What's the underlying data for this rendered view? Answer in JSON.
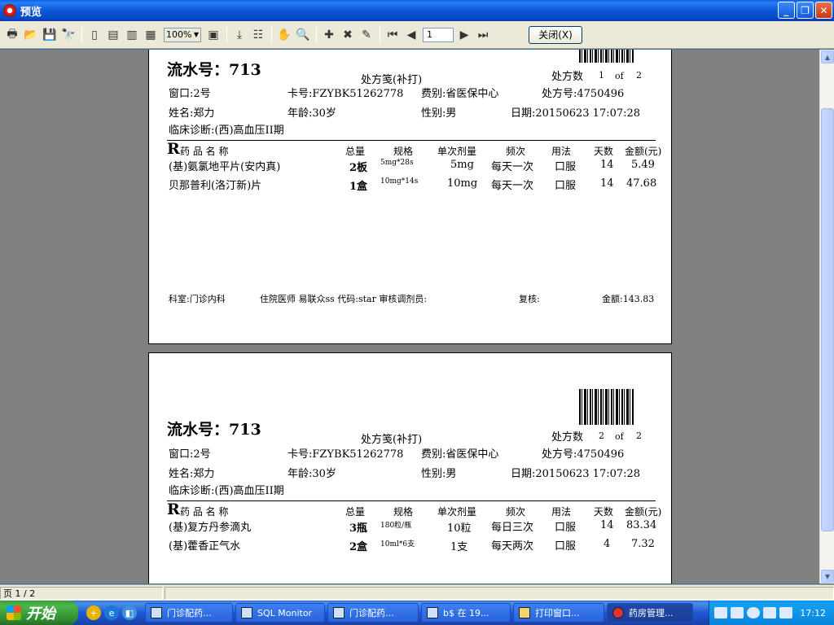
{
  "window": {
    "title": "预览",
    "minimize": "_",
    "maximize": "❐",
    "close": "✕"
  },
  "toolbar": {
    "zoom": "100%",
    "page_input": "1",
    "close_label": "关闭(X)"
  },
  "pages": [
    {
      "serial": "流水号：713",
      "header_title": "处方笺(补打)",
      "count_label": "处方数",
      "count_current": "1",
      "count_of": "of",
      "count_total": "2",
      "window_no": "窗口:2号",
      "card_no": "卡号:FZYBK51262778",
      "fee_type": "费别:省医保中心",
      "rx_no": "处方号:4750496",
      "name": "姓名:郑力",
      "age": "年龄:30岁",
      "gender": "性别:男",
      "date": "日期:20150623 17:07:28",
      "diagnosis": "临床诊断:(西)高血压II期",
      "rows": [
        {
          "name": "(基)氨氯地平片(安内真)",
          "qty": "2板",
          "spec": "5mg*28s",
          "dose": "5mg",
          "freq": "每天一次",
          "usage": "口服",
          "days": "14",
          "amount": "5.49"
        },
        {
          "name": "贝那普利(洛汀新)片",
          "qty": "1盒",
          "spec": "10mg*14s",
          "dose": "10mg",
          "freq": "每天一次",
          "usage": "口服",
          "days": "14",
          "amount": "47.68"
        }
      ],
      "footer": {
        "dept": "科室:门诊内科",
        "doctor": "住院医师 易联众ss 代码:star 审核调剂员:",
        "review": "复核:",
        "total": "金额:143.83"
      }
    },
    {
      "serial": "流水号：713",
      "header_title": "处方笺(补打)",
      "count_label": "处方数",
      "count_current": "2",
      "count_of": "of",
      "count_total": "2",
      "window_no": "窗口:2号",
      "card_no": "卡号:FZYBK51262778",
      "fee_type": "费别:省医保中心",
      "rx_no": "处方号:4750496",
      "name": "姓名:郑力",
      "age": "年龄:30岁",
      "gender": "性别:男",
      "date": "日期:20150623 17:07:28",
      "diagnosis": "临床诊断:(西)高血压II期",
      "rows": [
        {
          "name": "(基)复方丹参滴丸",
          "qty": "3瓶",
          "spec": "180粒/瓶",
          "dose": "10粒",
          "freq": "每日三次",
          "usage": "口服",
          "days": "14",
          "amount": "83.34"
        },
        {
          "name": "(基)藿香正气水",
          "qty": "2盒",
          "spec": "10ml*6支",
          "dose": "1支",
          "freq": "每天两次",
          "usage": "口服",
          "days": "4",
          "amount": "7.32"
        }
      ]
    }
  ],
  "table_headers": {
    "rx": "R",
    "name": "药 品 名 称",
    "qty": "总量",
    "spec": "规格",
    "dose": "单次剂量",
    "freq": "频次",
    "usage": "用法",
    "days": "天数",
    "amount": "金额(元)"
  },
  "status": {
    "page": "页 1 / 2"
  },
  "taskbar": {
    "start": "开始",
    "tasks": [
      "门诊配药...",
      "SQL Monitor",
      "门诊配药...",
      "b$ 在 19...",
      "打印窗口...",
      "药房管理..."
    ],
    "clock": "17:12"
  }
}
